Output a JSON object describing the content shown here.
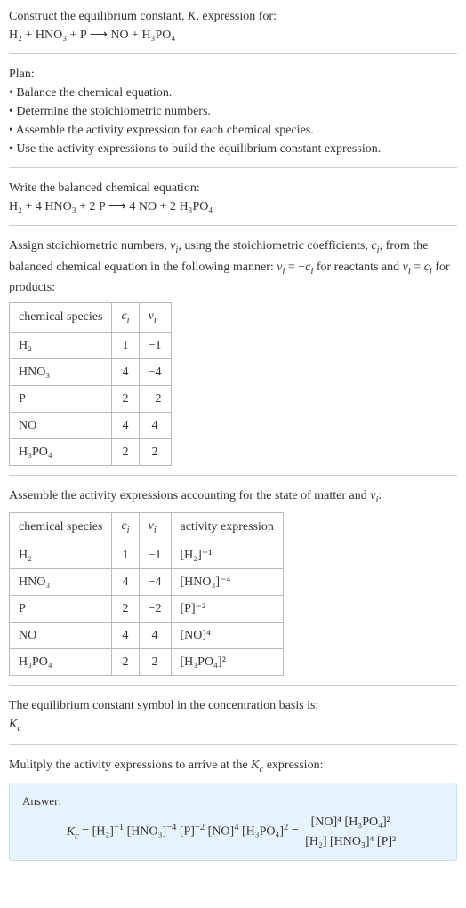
{
  "header": {
    "line1": "Construct the equilibrium constant, K, expression for:",
    "equation": "H₂ + HNO₃ + P ⟶ NO + H₃PO₄"
  },
  "plan": {
    "title": "Plan:",
    "items": [
      "• Balance the chemical equation.",
      "• Determine the stoichiometric numbers.",
      "• Assemble the activity expression for each chemical species.",
      "• Use the activity expressions to build the equilibrium constant expression."
    ]
  },
  "balanced": {
    "title": "Write the balanced chemical equation:",
    "equation": "H₂ + 4 HNO₃ + 2 P ⟶ 4 NO + 2 H₃PO₄"
  },
  "stoich": {
    "intro1": "Assign stoichiometric numbers, νᵢ, using the stoichiometric coefficients, cᵢ, from the balanced chemical equation in the following manner: νᵢ = −cᵢ for reactants and νᵢ = cᵢ for products:",
    "headers": [
      "chemical species",
      "cᵢ",
      "νᵢ"
    ],
    "rows": [
      {
        "sp": "H₂",
        "c": "1",
        "v": "−1"
      },
      {
        "sp": "HNO₃",
        "c": "4",
        "v": "−4"
      },
      {
        "sp": "P",
        "c": "2",
        "v": "−2"
      },
      {
        "sp": "NO",
        "c": "4",
        "v": "4"
      },
      {
        "sp": "H₃PO₄",
        "c": "2",
        "v": "2"
      }
    ]
  },
  "activity": {
    "intro": "Assemble the activity expressions accounting for the state of matter and νᵢ:",
    "headers": [
      "chemical species",
      "cᵢ",
      "νᵢ",
      "activity expression"
    ],
    "rows": [
      {
        "sp": "H₂",
        "c": "1",
        "v": "−1",
        "a": "[H₂]⁻¹"
      },
      {
        "sp": "HNO₃",
        "c": "4",
        "v": "−4",
        "a": "[HNO₃]⁻⁴"
      },
      {
        "sp": "P",
        "c": "2",
        "v": "−2",
        "a": "[P]⁻²"
      },
      {
        "sp": "NO",
        "c": "4",
        "v": "4",
        "a": "[NO]⁴"
      },
      {
        "sp": "H₃PO₄",
        "c": "2",
        "v": "2",
        "a": "[H₃PO₄]²"
      }
    ]
  },
  "symbol": {
    "line1": "The equilibrium constant symbol in the concentration basis is:",
    "line2": "K𝚌"
  },
  "multiply": {
    "title": "Mulitply the activity expressions to arrive at the K𝚌 expression:"
  },
  "answer": {
    "label": "Answer:",
    "lhs": "K𝚌 = [H₂]⁻¹ [HNO₃]⁻⁴ [P]⁻² [NO]⁴ [H₃PO₄]² =",
    "num": "[NO]⁴ [H₃PO₄]²",
    "den": "[H₂] [HNO₃]⁴ [P]²"
  }
}
